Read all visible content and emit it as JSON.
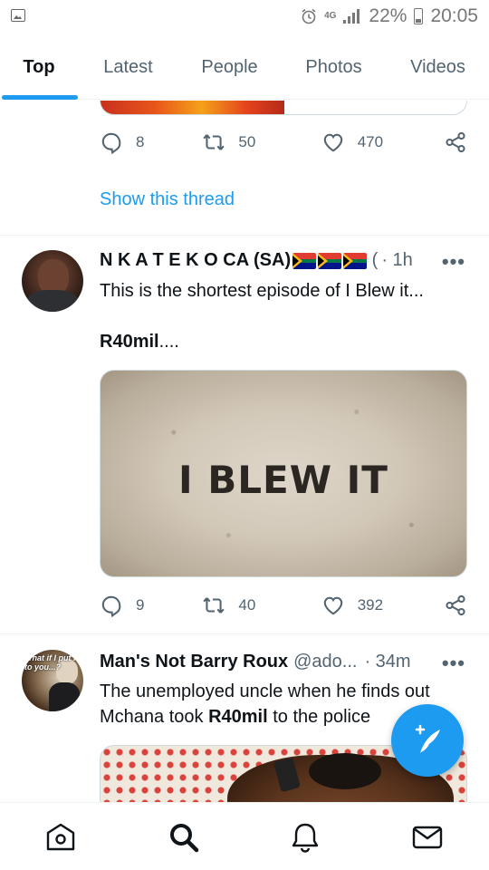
{
  "status_bar": {
    "network": "4G",
    "battery": "22%",
    "time": "20:05"
  },
  "tabs": [
    {
      "label": "Top",
      "active": true
    },
    {
      "label": "Latest",
      "active": false
    },
    {
      "label": "People",
      "active": false
    },
    {
      "label": "Photos",
      "active": false
    },
    {
      "label": "Videos",
      "active": false
    }
  ],
  "tweets": [
    {
      "replies": "8",
      "retweets": "50",
      "likes": "470",
      "show_thread": "Show this thread"
    },
    {
      "name": "N K A T E K O CA (SA)",
      "handle": " (",
      "time": "· 1h",
      "text": "This is the shortest episode of I Blew it...",
      "text_bold": "R40mil",
      "text_after_bold": "....",
      "media_title": "I BLEW IT",
      "replies": "9",
      "retweets": "40",
      "likes": "392"
    },
    {
      "name": "Man's Not Barry Roux",
      "handle": "@ado...",
      "time": "· 34m",
      "text_before_bold": "The unemployed uncle when he finds out Mchana took ",
      "text_bold": "R40mil",
      "text_after_bold": "  to the police",
      "avatar_caption": "What if I put it to you...?"
    }
  ],
  "colors": {
    "accent": "#1d9bf0",
    "text": "#0f1419",
    "muted": "#536471"
  },
  "icons": {
    "tab_underline": "active-tab-indicator",
    "compose": "compose-feather-icon",
    "nav": [
      "home-icon",
      "search-icon",
      "notifications-icon",
      "messages-icon"
    ]
  }
}
